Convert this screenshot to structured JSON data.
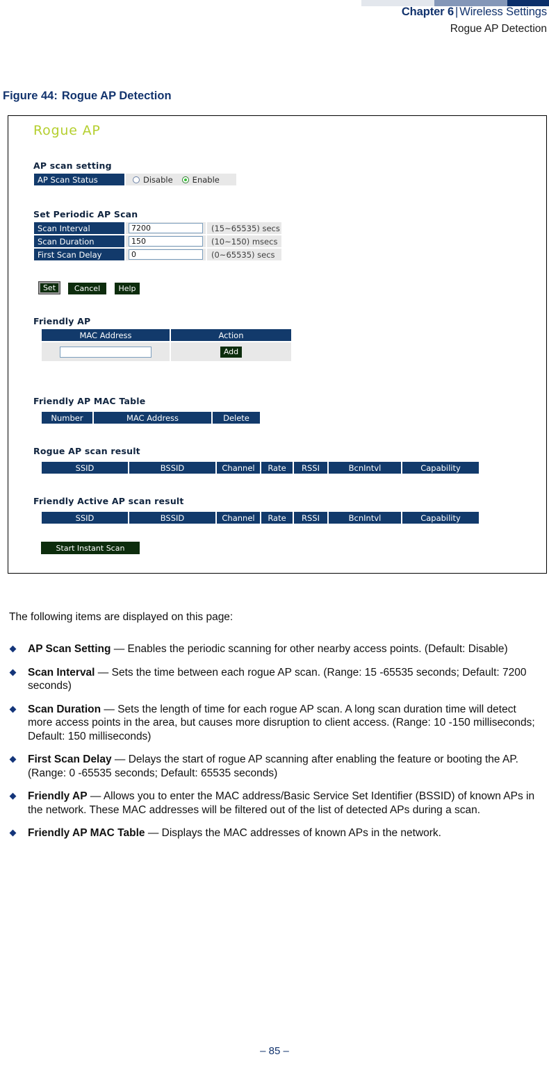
{
  "header": {
    "chapter": "Chapter 6",
    "separator": "|",
    "section": "Wireless Settings",
    "subsection": "Rogue AP Detection"
  },
  "figure": {
    "label": "Figure 44:",
    "title": "Rogue AP Detection"
  },
  "screenshot": {
    "page_title": "Rogue AP",
    "ap_scan_setting": {
      "heading": "AP scan setting",
      "row_label": "AP Scan Status",
      "option_disable": "Disable",
      "option_enable": "Enable",
      "selected": "Enable"
    },
    "periodic_scan": {
      "heading": "Set Periodic AP Scan",
      "rows": [
        {
          "label": "Scan Interval",
          "value": "7200",
          "hint": "(15~65535) secs"
        },
        {
          "label": "Scan Duration",
          "value": "150",
          "hint": "(10~150) msecs"
        },
        {
          "label": "First Scan Delay",
          "value": "0",
          "hint": "(0~65535) secs"
        }
      ],
      "buttons": {
        "set": "Set",
        "cancel": "Cancel",
        "help": "Help"
      }
    },
    "friendly_ap": {
      "heading": "Friendly AP",
      "columns": [
        "MAC Address",
        "Action"
      ],
      "input_value": "",
      "add_button": "Add"
    },
    "friendly_ap_mac_table": {
      "heading": "Friendly AP MAC Table",
      "columns": [
        "Number",
        "MAC Address",
        "Delete"
      ]
    },
    "rogue_scan_result": {
      "heading": "Rogue AP scan result",
      "columns": [
        "SSID",
        "BSSID",
        "Channel",
        "Rate",
        "RSSI",
        "BcnIntvl",
        "Capability"
      ]
    },
    "friendly_active_scan_result": {
      "heading": "Friendly Active AP scan result",
      "columns": [
        "SSID",
        "BSSID",
        "Channel",
        "Rate",
        "RSSI",
        "BcnIntvl",
        "Capability"
      ]
    },
    "instant_scan_button": "Start Instant Scan"
  },
  "body": {
    "intro": "The following items are displayed on this page:",
    "items": [
      {
        "term": "AP Scan Setting",
        "desc": " — Enables the periodic scanning for other nearby access points. (Default: Disable)"
      },
      {
        "term": "Scan Interval",
        "desc": " — Sets the time between each rogue AP scan. (Range: 15 -65535 seconds; Default: 7200 seconds)"
      },
      {
        "term": "Scan Duration",
        "desc": " — Sets the length of time for each rogue AP scan. A long scan duration time will detect more access points in the area, but causes more disruption to client access. (Range: 10 -150 milliseconds; Default: 150 milliseconds)"
      },
      {
        "term": "First Scan Delay",
        "desc": " — Delays the start of rogue AP scanning after enabling the feature or booting the AP. (Range: 0 -65535 seconds; Default: 65535 seconds)"
      },
      {
        "term": "Friendly AP",
        "desc": " — Allows you to enter the MAC address/Basic Service Set Identifier (BSSID) of known APs in the network. These MAC addresses will be filtered out of the list of detected APs during a scan."
      },
      {
        "term": "Friendly AP MAC Table",
        "desc": " — Displays the MAC addresses of known APs in the network."
      }
    ]
  },
  "page_number": "–  85  –"
}
